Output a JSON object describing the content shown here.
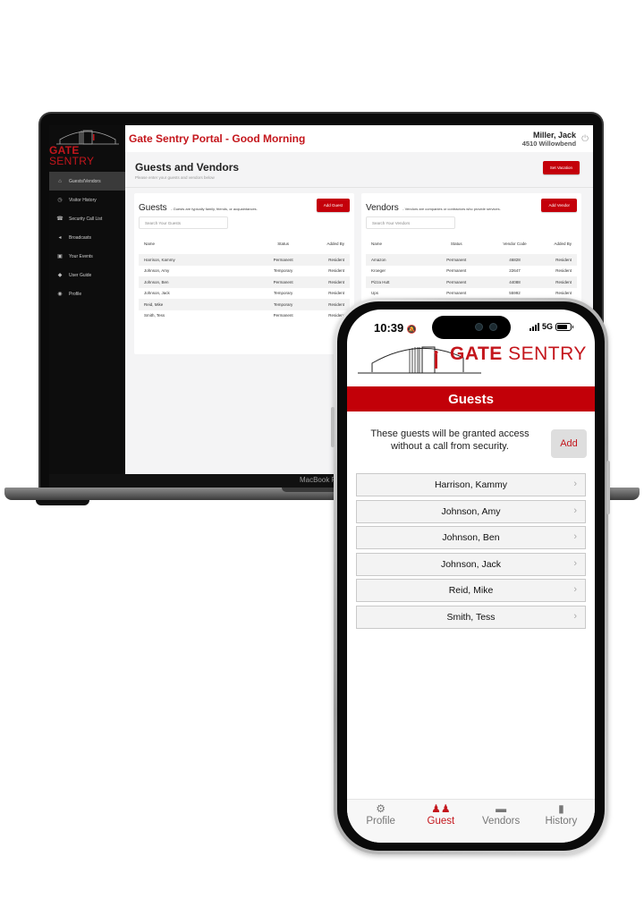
{
  "laptop": {
    "chin_label": "MacBook Pro",
    "sidebar": {
      "logo_gate": "GATE",
      "logo_sentry": "SENTRY",
      "items": [
        {
          "label": "Guests/Vendors",
          "icon": "lock-icon",
          "glyph": "⌂",
          "active": true
        },
        {
          "label": "Visitor History",
          "icon": "clock-icon",
          "glyph": "◷",
          "active": false
        },
        {
          "label": "Security Call List",
          "icon": "phone-icon",
          "glyph": "☎",
          "active": false
        },
        {
          "label": "Broadcasts",
          "icon": "megaphone-icon",
          "glyph": "◂",
          "active": false
        },
        {
          "label": "Your Events",
          "icon": "calendar-icon",
          "glyph": "▣",
          "active": false
        },
        {
          "label": "User Guide",
          "icon": "graduation-cap-icon",
          "glyph": "◆",
          "active": false
        },
        {
          "label": "Profile",
          "icon": "user-circle-icon",
          "glyph": "◉",
          "active": false
        }
      ]
    },
    "header": {
      "title": "Gate Sentry Portal  - Good Morning",
      "user_name": "Miller, Jack",
      "user_address": "4510 Willowbend"
    },
    "page": {
      "title": "Guests and Vendors",
      "subtitle": "Please enter your guests and vendors below",
      "set_vacation_label": "Set Vacation"
    },
    "guests_panel": {
      "title": "Guests",
      "description": "- Guests are typically family, friends, or acquaintances.",
      "add_label": "Add Guest",
      "search_placeholder": "Search Your Guests",
      "columns": [
        "Name",
        "Status",
        "Added By"
      ],
      "rows": [
        [
          "Harrison, Kammy",
          "Permanent",
          "Resident"
        ],
        [
          "Johnson, Amy",
          "Temporary",
          "Resident"
        ],
        [
          "Johnson, Ben",
          "Permanent",
          "Resident"
        ],
        [
          "Johnson, Jack",
          "Temporary",
          "Resident"
        ],
        [
          "Reid, Mike",
          "Temporary",
          "Resident"
        ],
        [
          "Smith, Tess",
          "Permanent",
          "Resident"
        ]
      ]
    },
    "vendors_panel": {
      "title": "Vendors",
      "description": "- Vendors are companies or contractors who provide services.",
      "add_label": "Add Vendor",
      "search_placeholder": "Search Your Vendors",
      "columns": [
        "Name",
        "Status",
        "Vendor Code",
        "Added By"
      ],
      "rows": [
        [
          "Amazon",
          "Permanent",
          "46828",
          "Resident"
        ],
        [
          "Kroeger",
          "Permanent",
          "22647",
          "Resident"
        ],
        [
          "Pizza Hutt",
          "Permanent",
          "44088",
          "Resident"
        ],
        [
          "Ups",
          "Permanent",
          "55992",
          "Resident"
        ]
      ]
    }
  },
  "phone": {
    "status": {
      "time": "10:39",
      "network": "5G"
    },
    "logo_gate": "GATE",
    "logo_sentry": " SENTRY",
    "header_title": "Guests",
    "intro_text": "These guests will be granted access without a call from security.",
    "add_label": "Add",
    "guests": [
      "Harrison, Kammy",
      "Johnson, Amy",
      "Johnson, Ben",
      "Johnson, Jack",
      "Reid, Mike",
      "Smith, Tess"
    ],
    "tabs": [
      {
        "label": "Profile",
        "icon": "gear-icon",
        "glyph": "⚙",
        "active": false
      },
      {
        "label": "Guest",
        "icon": "users-icon",
        "glyph": "♟♟",
        "active": true
      },
      {
        "label": "Vendors",
        "icon": "id-card-icon",
        "glyph": "▬",
        "active": false
      },
      {
        "label": "History",
        "icon": "clipboard-icon",
        "glyph": "▮",
        "active": false
      }
    ],
    "colors": {
      "brand_red": "#c4161c",
      "header_red": "#c20008"
    }
  }
}
